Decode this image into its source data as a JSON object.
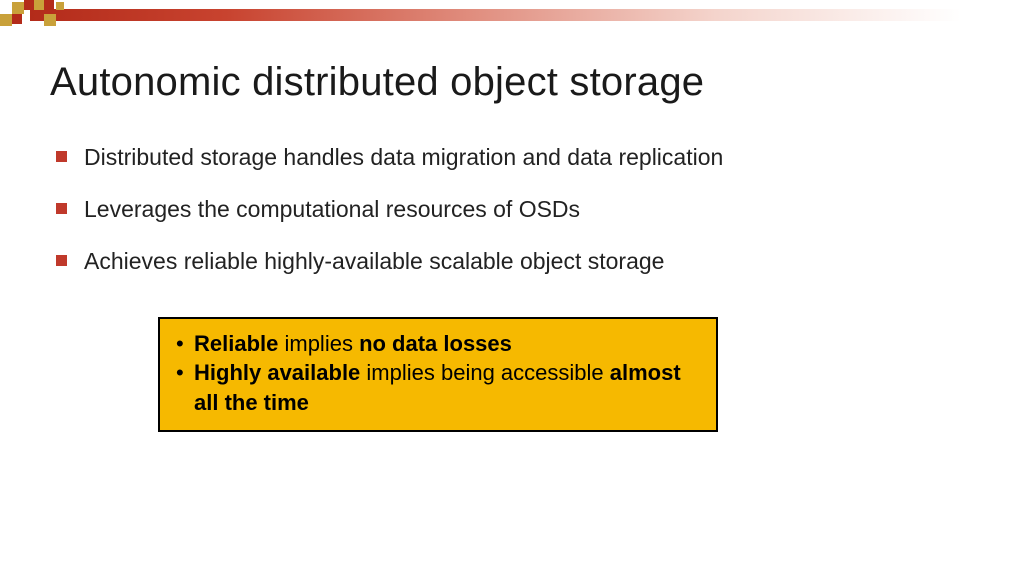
{
  "title": "Autonomic distributed object storage",
  "bullets": [
    "Distributed storage handles data migration and data replication",
    "Leverages the computational resources of OSDs",
    "Achieves reliable highly-available scalable object storage"
  ],
  "callout": {
    "item1": {
      "p1": "Reliable",
      "p2": " implies ",
      "p3": "no data losses"
    },
    "item2": {
      "p1": "Highly available",
      "p2": " implies being accessible ",
      "p3": "almost all the time"
    }
  }
}
